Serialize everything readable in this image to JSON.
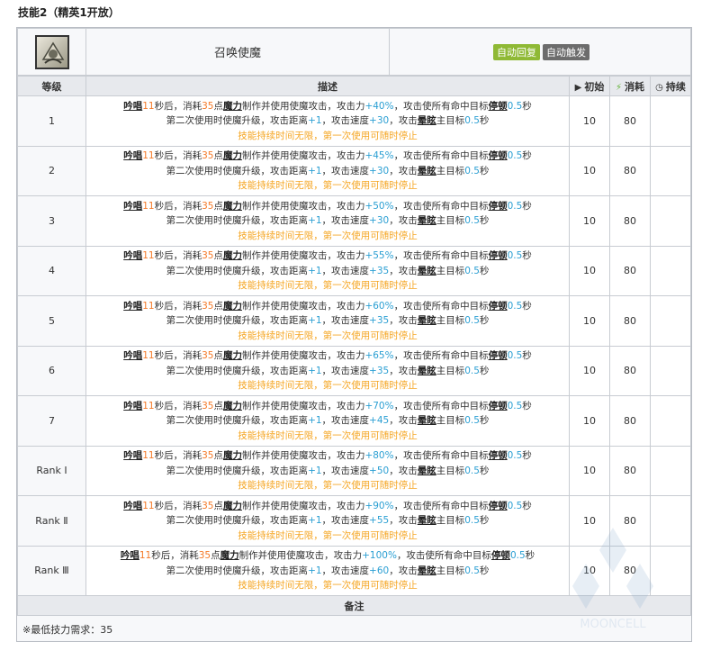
{
  "page": {
    "heading": "技能2（精英1开放）"
  },
  "skill": {
    "icon": "summon-demon-skill-icon",
    "name": "召唤使魔",
    "tags": [
      "自动回复",
      "自动触发"
    ]
  },
  "headers": {
    "level": "等级",
    "desc": "描述",
    "init": "初始",
    "cost": "消耗",
    "duration": "持续"
  },
  "rows": [
    {
      "level": "1",
      "atk": "+40%",
      "spd": "+30",
      "init": "10",
      "cost": "80"
    },
    {
      "level": "2",
      "atk": "+45%",
      "spd": "+30",
      "init": "10",
      "cost": "80"
    },
    {
      "level": "3",
      "atk": "+50%",
      "spd": "+30",
      "init": "10",
      "cost": "80"
    },
    {
      "level": "4",
      "atk": "+55%",
      "spd": "+35",
      "init": "10",
      "cost": "80"
    },
    {
      "level": "5",
      "atk": "+60%",
      "spd": "+35",
      "init": "10",
      "cost": "80"
    },
    {
      "level": "6",
      "atk": "+65%",
      "spd": "+35",
      "init": "10",
      "cost": "80"
    },
    {
      "level": "7",
      "atk": "+70%",
      "spd": "+45",
      "init": "10",
      "cost": "80"
    },
    {
      "level": "Rank Ⅰ",
      "atk": "+80%",
      "spd": "+50",
      "init": "10",
      "cost": "80"
    },
    {
      "level": "Rank Ⅱ",
      "atk": "+90%",
      "spd": "+55",
      "init": "10",
      "cost": "80"
    },
    {
      "level": "Rank Ⅲ",
      "atk": "+100%",
      "spd": "+60",
      "init": "10",
      "cost": "80"
    }
  ],
  "desc_text": {
    "chant": "吟唱",
    "chant_time": "11",
    "t1": "秒后，消耗",
    "mana_cost": "35",
    "t2": "点",
    "mana": "魔力",
    "t3": "制作并使用使魔攻击，攻击力",
    "t4": "，攻击使所有命中目标",
    "stun": "停顿",
    "stun_time": "0.5",
    "t5": "秒",
    "l2a": "第二次使用时使魔升级，攻击距离",
    "range": "+1",
    "l2b": "，攻击速度",
    "l2c": "，攻击",
    "dizzy": "晕眩",
    "l2d": "主目标",
    "dizzy_time": "0.5",
    "l2e": "秒",
    "l3": "技能持续时间无限，第一次使用可随时停止"
  },
  "note": {
    "header": "备注",
    "text": "※最低技力需求：35"
  },
  "watermark": "MOONCELL",
  "colors": {
    "accent_orange": "#f47a29",
    "accent_blue": "#2b9fd3",
    "accent_yellow": "#f5a623",
    "tag_green": "#8fb935",
    "tag_gray": "#6c6c6c"
  }
}
